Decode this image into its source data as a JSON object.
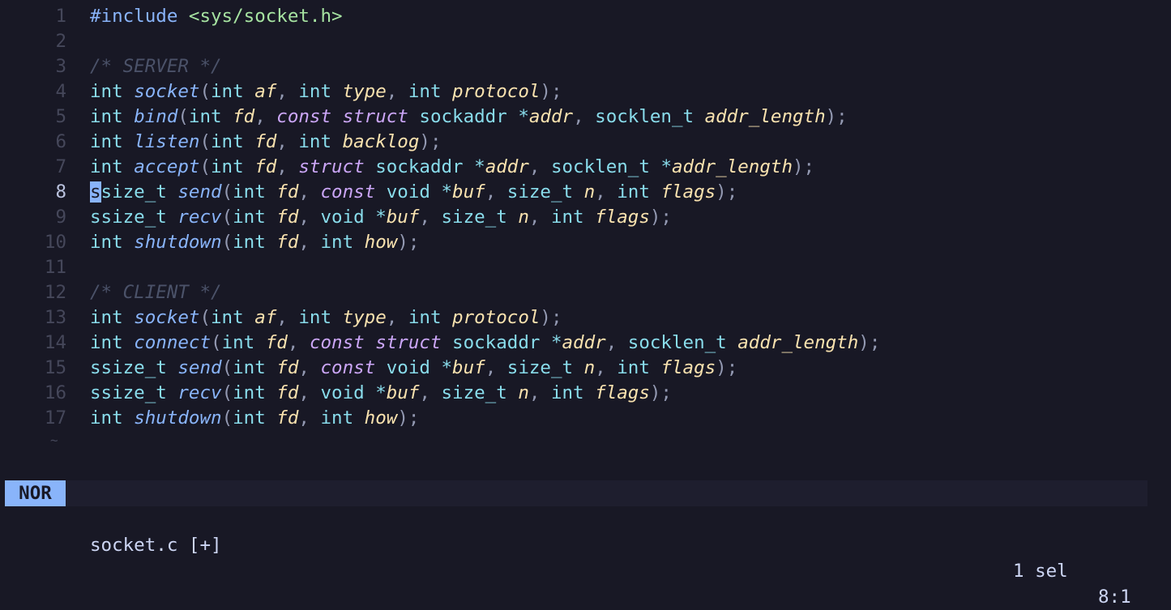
{
  "editor": {
    "lines": [
      {
        "n": "1",
        "tokens": [
          [
            "pp",
            "#include "
          ],
          [
            "str",
            "<sys/socket.h>"
          ]
        ]
      },
      {
        "n": "2",
        "tokens": []
      },
      {
        "n": "3",
        "tokens": [
          [
            "com",
            "/* SERVER */"
          ]
        ]
      },
      {
        "n": "4",
        "tokens": [
          [
            "type",
            "int "
          ],
          [
            "fn",
            "socket"
          ],
          [
            "punc",
            "("
          ],
          [
            "type",
            "int "
          ],
          [
            "par",
            "af"
          ],
          [
            "punc",
            ", "
          ],
          [
            "type",
            "int "
          ],
          [
            "par",
            "type"
          ],
          [
            "punc",
            ", "
          ],
          [
            "type",
            "int "
          ],
          [
            "par",
            "protocol"
          ],
          [
            "punc",
            ");"
          ]
        ]
      },
      {
        "n": "5",
        "tokens": [
          [
            "type",
            "int "
          ],
          [
            "fn",
            "bind"
          ],
          [
            "punc",
            "("
          ],
          [
            "type",
            "int "
          ],
          [
            "par",
            "fd"
          ],
          [
            "punc",
            ", "
          ],
          [
            "kw",
            "const struct "
          ],
          [
            "type",
            "sockaddr "
          ],
          [
            "op",
            "*"
          ],
          [
            "par",
            "addr"
          ],
          [
            "punc",
            ", "
          ],
          [
            "type",
            "socklen_t "
          ],
          [
            "par",
            "addr_length"
          ],
          [
            "punc",
            ");"
          ]
        ]
      },
      {
        "n": "6",
        "tokens": [
          [
            "type",
            "int "
          ],
          [
            "fn",
            "listen"
          ],
          [
            "punc",
            "("
          ],
          [
            "type",
            "int "
          ],
          [
            "par",
            "fd"
          ],
          [
            "punc",
            ", "
          ],
          [
            "type",
            "int "
          ],
          [
            "par",
            "backlog"
          ],
          [
            "punc",
            ");"
          ]
        ]
      },
      {
        "n": "7",
        "tokens": [
          [
            "type",
            "int "
          ],
          [
            "fn",
            "accept"
          ],
          [
            "punc",
            "("
          ],
          [
            "type",
            "int "
          ],
          [
            "par",
            "fd"
          ],
          [
            "punc",
            ", "
          ],
          [
            "kw",
            "struct "
          ],
          [
            "type",
            "sockaddr "
          ],
          [
            "op",
            "*"
          ],
          [
            "par",
            "addr"
          ],
          [
            "punc",
            ", "
          ],
          [
            "type",
            "socklen_t "
          ],
          [
            "op",
            "*"
          ],
          [
            "par",
            "addr_length"
          ],
          [
            "punc",
            ");"
          ]
        ]
      },
      {
        "n": "8",
        "tokens": [
          [
            "cursor",
            "s"
          ],
          [
            "type",
            "size_t "
          ],
          [
            "fn",
            "send"
          ],
          [
            "punc",
            "("
          ],
          [
            "type",
            "int "
          ],
          [
            "par",
            "fd"
          ],
          [
            "punc",
            ", "
          ],
          [
            "kw",
            "const "
          ],
          [
            "type",
            "void "
          ],
          [
            "op",
            "*"
          ],
          [
            "par",
            "buf"
          ],
          [
            "punc",
            ", "
          ],
          [
            "type",
            "size_t "
          ],
          [
            "par",
            "n"
          ],
          [
            "punc",
            ", "
          ],
          [
            "type",
            "int "
          ],
          [
            "par",
            "flags"
          ],
          [
            "punc",
            ");"
          ]
        ]
      },
      {
        "n": "9",
        "tokens": [
          [
            "type",
            "ssize_t "
          ],
          [
            "fn",
            "recv"
          ],
          [
            "punc",
            "("
          ],
          [
            "type",
            "int "
          ],
          [
            "par",
            "fd"
          ],
          [
            "punc",
            ", "
          ],
          [
            "type",
            "void "
          ],
          [
            "op",
            "*"
          ],
          [
            "par",
            "buf"
          ],
          [
            "punc",
            ", "
          ],
          [
            "type",
            "size_t "
          ],
          [
            "par",
            "n"
          ],
          [
            "punc",
            ", "
          ],
          [
            "type",
            "int "
          ],
          [
            "par",
            "flags"
          ],
          [
            "punc",
            ");"
          ]
        ]
      },
      {
        "n": "10",
        "tokens": [
          [
            "type",
            "int "
          ],
          [
            "fn",
            "shutdown"
          ],
          [
            "punc",
            "("
          ],
          [
            "type",
            "int "
          ],
          [
            "par",
            "fd"
          ],
          [
            "punc",
            ", "
          ],
          [
            "type",
            "int "
          ],
          [
            "par",
            "how"
          ],
          [
            "punc",
            ");"
          ]
        ]
      },
      {
        "n": "11",
        "tokens": []
      },
      {
        "n": "12",
        "tokens": [
          [
            "com",
            "/* CLIENT */"
          ]
        ]
      },
      {
        "n": "13",
        "tokens": [
          [
            "type",
            "int "
          ],
          [
            "fn",
            "socket"
          ],
          [
            "punc",
            "("
          ],
          [
            "type",
            "int "
          ],
          [
            "par",
            "af"
          ],
          [
            "punc",
            ", "
          ],
          [
            "type",
            "int "
          ],
          [
            "par",
            "type"
          ],
          [
            "punc",
            ", "
          ],
          [
            "type",
            "int "
          ],
          [
            "par",
            "protocol"
          ],
          [
            "punc",
            ");"
          ]
        ]
      },
      {
        "n": "14",
        "tokens": [
          [
            "type",
            "int "
          ],
          [
            "fn",
            "connect"
          ],
          [
            "punc",
            "("
          ],
          [
            "type",
            "int "
          ],
          [
            "par",
            "fd"
          ],
          [
            "punc",
            ", "
          ],
          [
            "kw",
            "const struct "
          ],
          [
            "type",
            "sockaddr "
          ],
          [
            "op",
            "*"
          ],
          [
            "par",
            "addr"
          ],
          [
            "punc",
            ", "
          ],
          [
            "type",
            "socklen_t "
          ],
          [
            "par",
            "addr_length"
          ],
          [
            "punc",
            ");"
          ]
        ]
      },
      {
        "n": "15",
        "tokens": [
          [
            "type",
            "ssize_t "
          ],
          [
            "fn",
            "send"
          ],
          [
            "punc",
            "("
          ],
          [
            "type",
            "int "
          ],
          [
            "par",
            "fd"
          ],
          [
            "punc",
            ", "
          ],
          [
            "kw",
            "const "
          ],
          [
            "type",
            "void "
          ],
          [
            "op",
            "*"
          ],
          [
            "par",
            "buf"
          ],
          [
            "punc",
            ", "
          ],
          [
            "type",
            "size_t "
          ],
          [
            "par",
            "n"
          ],
          [
            "punc",
            ", "
          ],
          [
            "type",
            "int "
          ],
          [
            "par",
            "flags"
          ],
          [
            "punc",
            ");"
          ]
        ]
      },
      {
        "n": "16",
        "tokens": [
          [
            "type",
            "ssize_t "
          ],
          [
            "fn",
            "recv"
          ],
          [
            "punc",
            "("
          ],
          [
            "type",
            "int "
          ],
          [
            "par",
            "fd"
          ],
          [
            "punc",
            ", "
          ],
          [
            "type",
            "void "
          ],
          [
            "op",
            "*"
          ],
          [
            "par",
            "buf"
          ],
          [
            "punc",
            ", "
          ],
          [
            "type",
            "size_t "
          ],
          [
            "par",
            "n"
          ],
          [
            "punc",
            ", "
          ],
          [
            "type",
            "int "
          ],
          [
            "par",
            "flags"
          ],
          [
            "punc",
            ");"
          ]
        ]
      },
      {
        "n": "17",
        "tokens": [
          [
            "type",
            "int "
          ],
          [
            "fn",
            "shutdown"
          ],
          [
            "punc",
            "("
          ],
          [
            "type",
            "int "
          ],
          [
            "par",
            "fd"
          ],
          [
            "punc",
            ", "
          ],
          [
            "type",
            "int "
          ],
          [
            "par",
            "how"
          ],
          [
            "punc",
            ");"
          ]
        ]
      }
    ],
    "current_line": "8",
    "eof_marker": "~"
  },
  "statusbar": {
    "mode": "NOR",
    "filename": "socket.c [+]",
    "selection": "1 sel",
    "position": "8:1"
  },
  "colors": {
    "background": "#181825",
    "statusbar_bg": "#1e1e2e",
    "mode_bg": "#89b4fa",
    "type": "#89dceb",
    "function": "#89b4fa",
    "parameter": "#f9e2af",
    "keyword": "#cba6f7",
    "string": "#a6e3a1",
    "comment": "#4b5269"
  }
}
